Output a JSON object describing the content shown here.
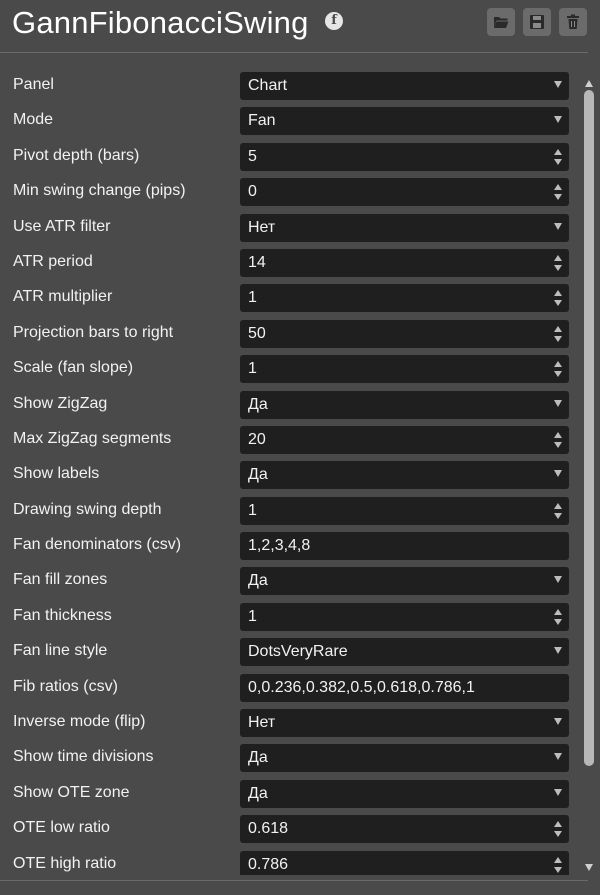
{
  "header": {
    "title": "GannFibonacciSwing",
    "info_icon": "info-icon",
    "buttons": [
      {
        "name": "open-folder-button",
        "icon": "folder-open-icon"
      },
      {
        "name": "save-button",
        "icon": "floppy-disk-icon"
      },
      {
        "name": "delete-button",
        "icon": "trash-icon"
      }
    ]
  },
  "rows": [
    {
      "label": "Panel",
      "value": "Chart",
      "kind": "select"
    },
    {
      "label": "Mode",
      "value": "Fan",
      "kind": "select"
    },
    {
      "label": "Pivot depth (bars)",
      "value": "5",
      "kind": "number"
    },
    {
      "label": "Min swing change (pips)",
      "value": "0",
      "kind": "number"
    },
    {
      "label": "Use ATR filter",
      "value": "Нет",
      "kind": "select"
    },
    {
      "label": "ATR period",
      "value": "14",
      "kind": "number"
    },
    {
      "label": "ATR multiplier",
      "value": "1",
      "kind": "number"
    },
    {
      "label": "Projection bars to right",
      "value": "50",
      "kind": "number"
    },
    {
      "label": "Scale (fan slope)",
      "value": "1",
      "kind": "number"
    },
    {
      "label": "Show ZigZag",
      "value": "Да",
      "kind": "select"
    },
    {
      "label": "Max ZigZag segments",
      "value": "20",
      "kind": "number"
    },
    {
      "label": "Show labels",
      "value": "Да",
      "kind": "select"
    },
    {
      "label": "Drawing swing depth",
      "value": "1",
      "kind": "number"
    },
    {
      "label": "Fan denominators (csv)",
      "value": "1,2,3,4,8",
      "kind": "text"
    },
    {
      "label": "Fan fill zones",
      "value": "Да",
      "kind": "select"
    },
    {
      "label": "Fan thickness",
      "value": "1",
      "kind": "number"
    },
    {
      "label": "Fan line style",
      "value": "DotsVeryRare",
      "kind": "select"
    },
    {
      "label": "Fib ratios (csv)",
      "value": "0,0.236,0.382,0.5,0.618,0.786,1",
      "kind": "text"
    },
    {
      "label": "Inverse mode (flip)",
      "value": "Нет",
      "kind": "select"
    },
    {
      "label": "Show time divisions",
      "value": "Да",
      "kind": "select"
    },
    {
      "label": "Show OTE zone",
      "value": "Да",
      "kind": "select"
    },
    {
      "label": "OTE low ratio",
      "value": "0.618",
      "kind": "number"
    },
    {
      "label": "OTE high ratio",
      "value": "0.786",
      "kind": "number"
    }
  ],
  "colors": {
    "background": "#4a4a4a",
    "control_background": "#1f1f1f",
    "text": "#f2f2f2",
    "scroll_thumb": "#b8b8b8"
  }
}
